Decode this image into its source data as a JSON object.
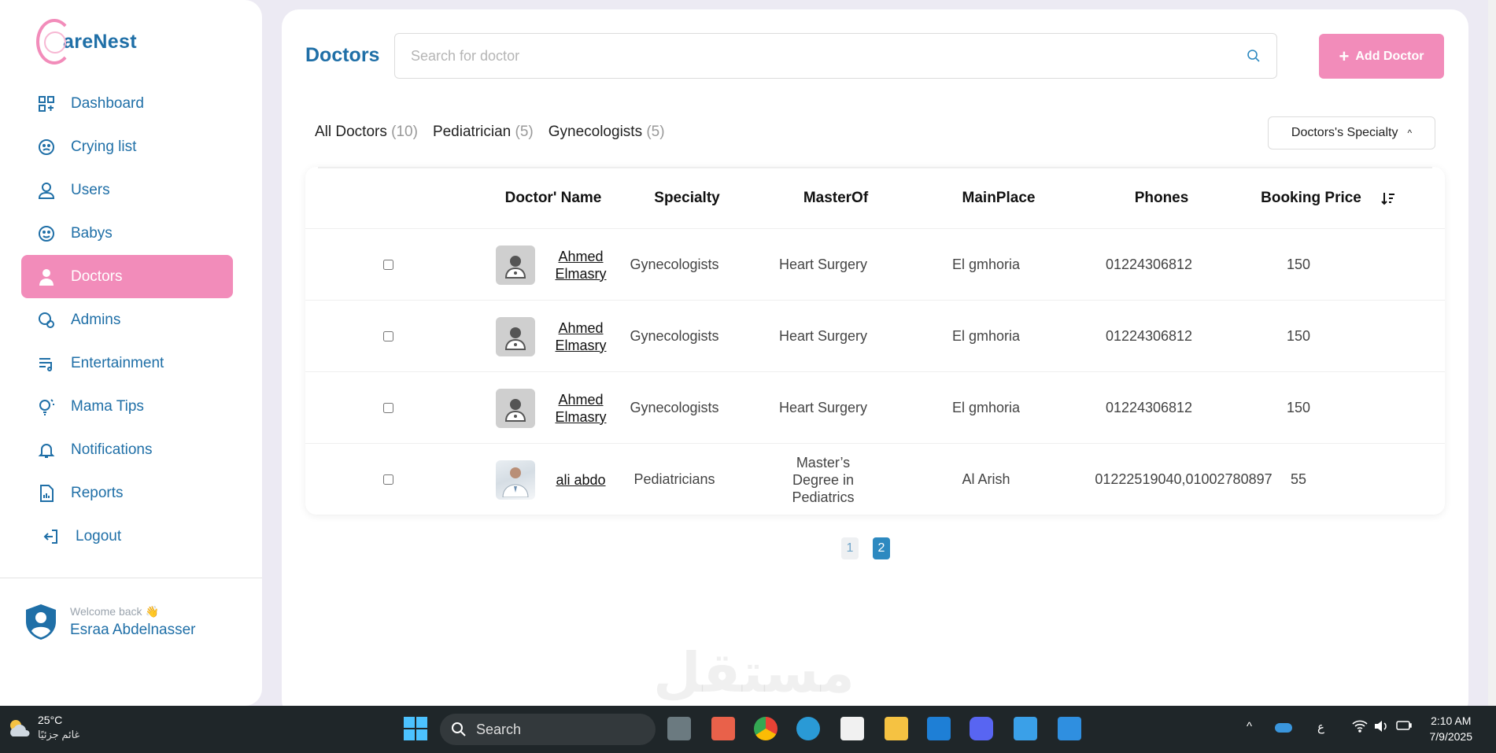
{
  "app": {
    "logo_text": "areNest"
  },
  "sidebar": {
    "items": [
      {
        "label": "Dashboard",
        "icon": "dashboard-icon"
      },
      {
        "label": "Crying list",
        "icon": "crying-face-icon"
      },
      {
        "label": "Users",
        "icon": "user-icon"
      },
      {
        "label": "Babys",
        "icon": "baby-face-icon"
      },
      {
        "label": "Doctors",
        "icon": "doctor-icon",
        "active": true
      },
      {
        "label": "Admins",
        "icon": "admin-icon"
      },
      {
        "label": "Entertainment",
        "icon": "playlist-icon"
      },
      {
        "label": "Mama Tips",
        "icon": "lightbulb-icon"
      },
      {
        "label": "Notifications",
        "icon": "bell-icon"
      },
      {
        "label": "Reports",
        "icon": "report-icon"
      },
      {
        "label": "Logout",
        "icon": "logout-icon"
      }
    ],
    "user": {
      "welcome": "Welcome back 👋",
      "name": "Esraa Abdelnasser"
    }
  },
  "main": {
    "title": "Doctors",
    "search_placeholder": "Search for doctor",
    "add_button": "Add Doctor",
    "filters": [
      {
        "label": "All Doctors",
        "count": "(10)"
      },
      {
        "label": "Pediatrician",
        "count": "(5)"
      },
      {
        "label": "Gynecologists",
        "count": "(5)"
      }
    ],
    "specialty_dropdown": "Doctors's Specialty",
    "table": {
      "columns": [
        "Doctor' Name",
        "Specialty",
        "MasterOf",
        "MainPlace",
        "Phones",
        "Booking Price"
      ],
      "rows": [
        {
          "name": "Ahmed Elmasry",
          "specialty": "Gynecologists",
          "master": "Heart Surgery",
          "place": "El gmhoria",
          "phones": "01224306812",
          "price": "150"
        },
        {
          "name": "Ahmed Elmasry",
          "specialty": "Gynecologists",
          "master": "Heart Surgery",
          "place": "El gmhoria",
          "phones": "01224306812",
          "price": "150"
        },
        {
          "name": "Ahmed Elmasry",
          "specialty": "Gynecologists",
          "master": "Heart Surgery",
          "place": "El gmhoria",
          "phones": "01224306812",
          "price": "150"
        },
        {
          "name": "ali abdo",
          "specialty": "Pediatricians",
          "master": "Master’s Degree in Pediatrics",
          "place": "Al Arish",
          "phones": "01222519040,01002780897",
          "price": "55"
        }
      ]
    },
    "pagination": {
      "pages": [
        "1",
        "2"
      ],
      "current": "2"
    },
    "watermark": "مستقل"
  },
  "taskbar": {
    "weather_temp": "25°C",
    "weather_cond": "غائم جزئيًا",
    "search": "Search",
    "lang": "ع",
    "time": "2:10 AM",
    "date": "7/9/2025"
  },
  "colors": {
    "accent": "#f28cba",
    "primary": "#1f6fa7",
    "page_active": "#2d89c0"
  }
}
